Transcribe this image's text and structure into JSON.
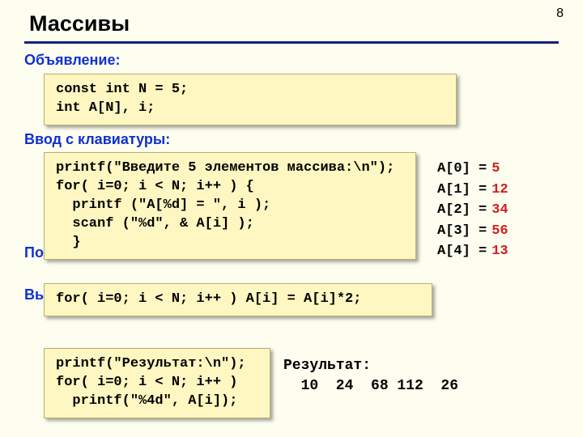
{
  "page_number": "8",
  "title": "Массивы",
  "sections": {
    "decl": "Объявление:",
    "input": "Ввод с клавиатуры:",
    "proc": "По",
    "out": "Вы"
  },
  "code": {
    "decl": "const int N = 5;\nint A[N], i;",
    "input": "printf(\"Введите 5 элементов массива:\\n\");\nfor( i=0; i < N; i++ ) {\n  printf (\"A[%d] = \", i );\n  scanf (\"%d\", & A[i] );\n  }",
    "trans": "for( i=0; i < N; i++ ) A[i] = A[i]*2;",
    "output": "printf(\"Результат:\\n\");\nfor( i=0; i < N; i++ )\n  printf(\"%4d\", A[i]);"
  },
  "arr": [
    {
      "k": "A[0] =",
      "v": "5"
    },
    {
      "k": "A[1] =",
      "v": "12"
    },
    {
      "k": "A[2] =",
      "v": "34"
    },
    {
      "k": "A[3] =",
      "v": "56"
    },
    {
      "k": "A[4] =",
      "v": "13"
    }
  ],
  "result": {
    "label": "Результат:",
    "values": "  10  24  68 112  26"
  }
}
